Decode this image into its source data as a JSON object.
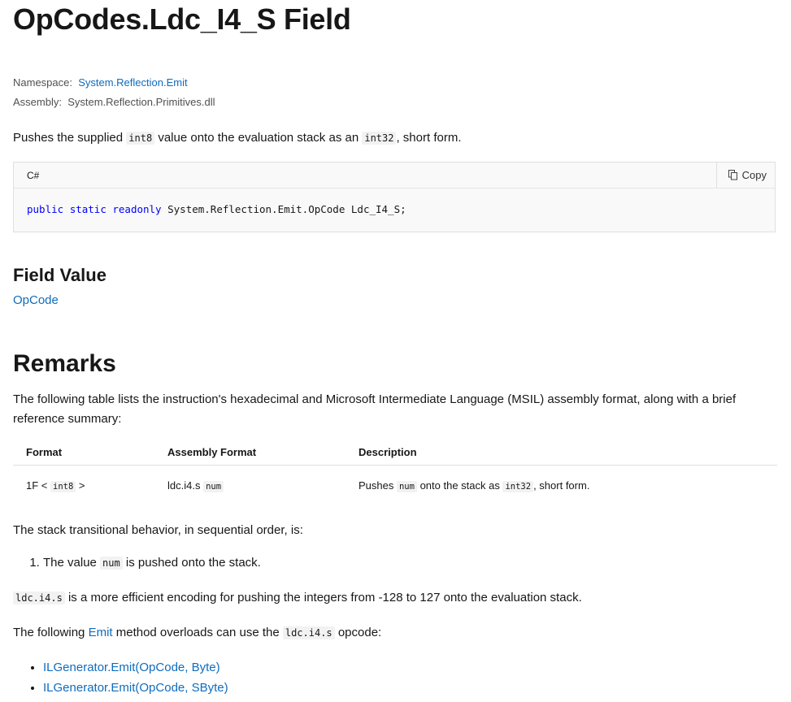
{
  "title": "OpCodes.Ldc_I4_S Field",
  "meta": {
    "namespace_label": "Namespace:",
    "namespace_value": "System.Reflection.Emit",
    "assembly_label": "Assembly:",
    "assembly_value": "System.Reflection.Primitives.dll"
  },
  "summary": {
    "part1": "Pushes the supplied ",
    "code1": "int8",
    "part2": " value onto the evaluation stack as an ",
    "code2": "int32",
    "part3": ", short form."
  },
  "code": {
    "language": "C#",
    "copy_label": "Copy",
    "kw1": "public",
    "kw2": "static",
    "kw3": "readonly",
    "rest": " System.Reflection.Emit.OpCode Ldc_I4_S;"
  },
  "field_value": {
    "heading": "Field Value",
    "type_link": "OpCode"
  },
  "remarks": {
    "heading": "Remarks",
    "intro": "The following table lists the instruction's hexadecimal and Microsoft Intermediate Language (MSIL) assembly format, along with a brief reference summary:",
    "table": {
      "headers": [
        "Format",
        "Assembly Format",
        "Description"
      ],
      "row": {
        "format_pre": "1F < ",
        "format_code": "int8",
        "format_post": " >",
        "asm_text": "ldc.i4.s ",
        "asm_code": "num",
        "desc_pre": "Pushes ",
        "desc_code1": "num",
        "desc_mid": " onto the stack as ",
        "desc_code2": "int32",
        "desc_post": ", short form."
      }
    },
    "stack_intro": "The stack transitional behavior, in sequential order, is:",
    "stack_item_pre": "The value ",
    "stack_item_code": "num",
    "stack_item_post": " is pushed onto the stack.",
    "efficiency_code": "ldc.i4.s",
    "efficiency_text": " is a more efficient encoding for pushing the integers from -128 to 127 onto the evaluation stack.",
    "overloads_pre": "The following ",
    "overloads_link": "Emit",
    "overloads_mid": " method overloads can use the ",
    "overloads_code": "ldc.i4.s",
    "overloads_post": " opcode:",
    "overload_links": [
      "ILGenerator.Emit(OpCode, Byte)",
      "ILGenerator.Emit(OpCode, SByte)"
    ]
  }
}
